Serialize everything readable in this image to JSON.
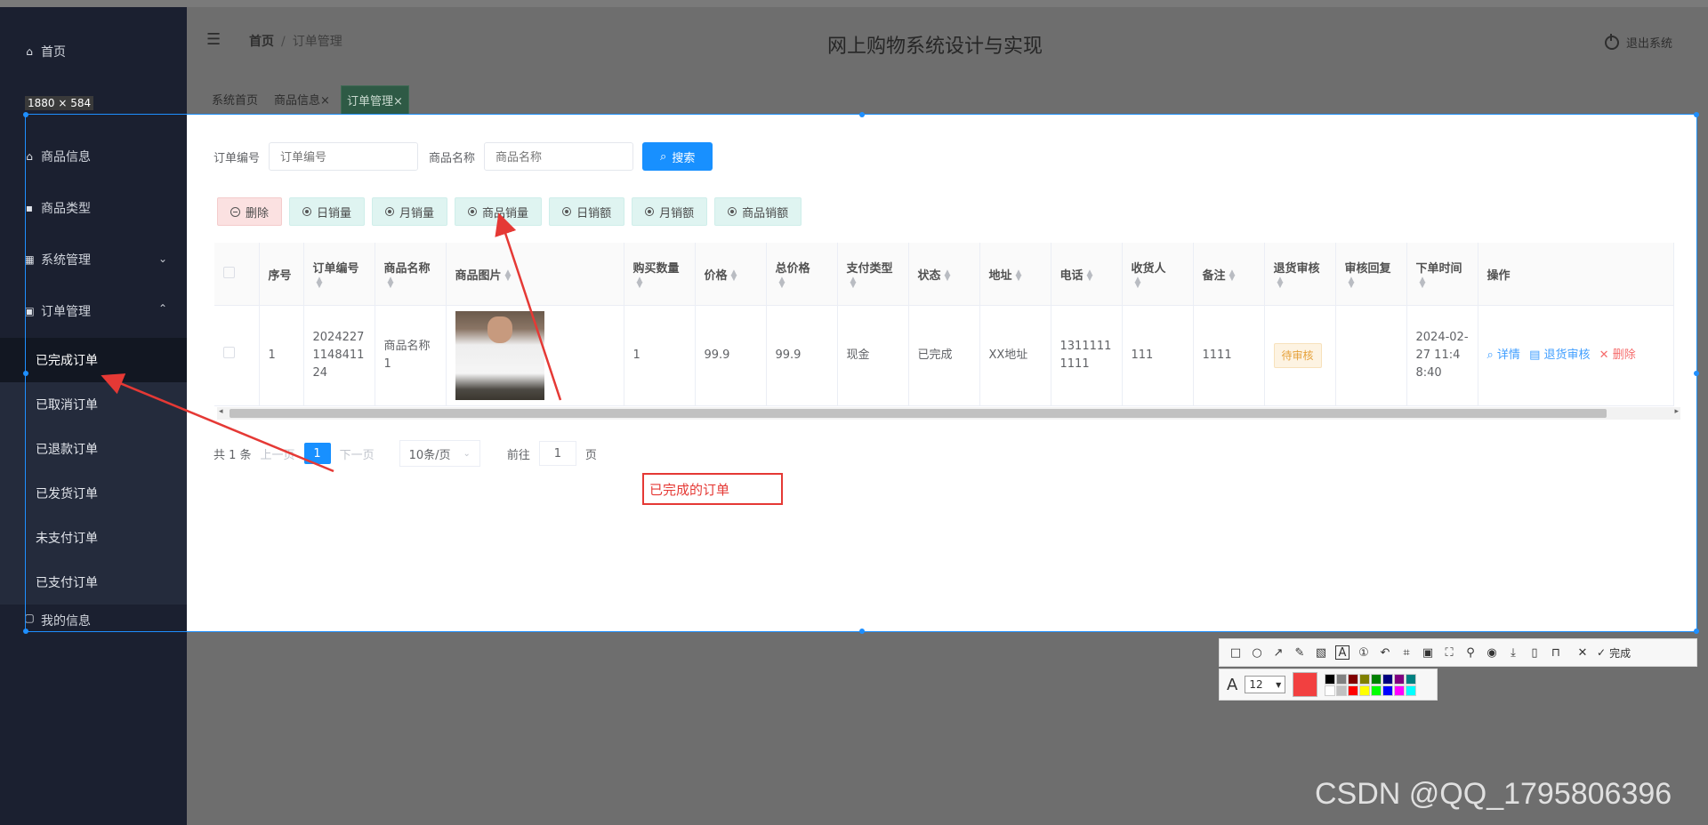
{
  "sidebar": {
    "home": "首页",
    "items": [
      {
        "label": "商品信息",
        "icon": "house-icon"
      },
      {
        "label": "商品类型",
        "icon": "chat-icon"
      },
      {
        "label": "系统管理",
        "icon": "grid-icon"
      },
      {
        "label": "订单管理",
        "icon": "clipboard-icon"
      }
    ],
    "order_sub": [
      "已完成订单",
      "已取消订单",
      "已退款订单",
      "已发货订单",
      "未支付订单",
      "已支付订单"
    ],
    "my_info": "我的信息"
  },
  "header": {
    "breadcrumb_home": "首页",
    "breadcrumb_current": "订单管理",
    "title": "网上购物系统设计与实现",
    "logout": "退出系统"
  },
  "tabs": [
    "系统首页",
    "商品信息",
    "订单管理"
  ],
  "capture": {
    "size_label": "1880 × 584"
  },
  "search": {
    "order_no_label": "订单编号",
    "order_no_placeholder": "订单编号",
    "product_name_label": "商品名称",
    "product_name_placeholder": "商品名称",
    "search_button": "搜索"
  },
  "actions": [
    "删除",
    "日销量",
    "月销量",
    "商品销量",
    "日销额",
    "月销额",
    "商品销额"
  ],
  "table": {
    "columns": [
      "序号",
      "订单编号",
      "商品名称",
      "商品图片",
      "购买数量",
      "价格",
      "总价格",
      "支付类型",
      "状态",
      "地址",
      "电话",
      "收货人",
      "备注",
      "退货审核",
      "审核回复",
      "下单时间",
      "操作"
    ],
    "rows": [
      {
        "index": "1",
        "order_no": "2024227114841124",
        "product_name": "商品名称1",
        "quantity": "1",
        "price": "99.9",
        "total": "99.9",
        "pay_type": "现金",
        "status": "已完成",
        "address": "XX地址",
        "phone": "13111111111",
        "receiver": "111",
        "remark": "1111",
        "return_audit": "待审核",
        "audit_reply": "",
        "order_time": "2024-02-27 11:48:40"
      }
    ],
    "row_ops": {
      "detail": "详情",
      "return_audit": "退货审核",
      "delete": "删除"
    }
  },
  "pagination": {
    "total": "共 1 条",
    "prev": "上一页",
    "current": "1",
    "next": "下一页",
    "page_size": "10条/页",
    "goto": "前往",
    "goto_value": "1",
    "page_unit": "页"
  },
  "annotation": {
    "text": "已完成的订单",
    "color": "#e53935"
  },
  "screenshot_tool": {
    "done": "完成",
    "font_size": "12",
    "current_color": "#f24040",
    "palette": [
      "#000000",
      "#808080",
      "#800000",
      "#808000",
      "#008000",
      "#000080",
      "#800080",
      "#008080",
      "#ffffff",
      "#c0c0c0",
      "#ff0000",
      "#ffff00",
      "#00ff00",
      "#0000ff",
      "#ff00ff",
      "#00ffff"
    ]
  },
  "watermark": "CSDN @QQ_1795806396",
  "theme": {
    "primary": "#1890ff",
    "sidebar_bg": "#1b2030",
    "active_tab": "#2e5a45"
  }
}
